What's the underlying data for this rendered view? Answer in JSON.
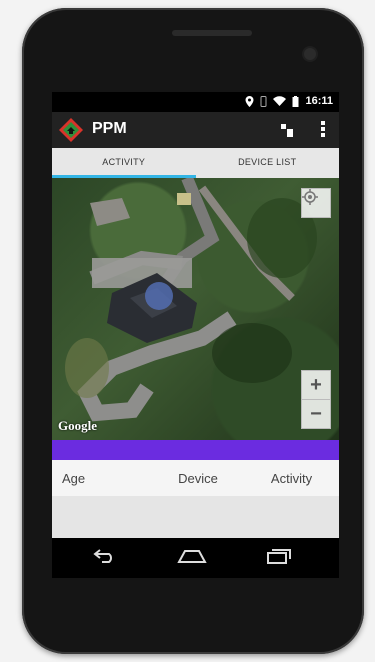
{
  "status_bar": {
    "time": "16:11",
    "icons": [
      "location-icon",
      "vibrate-icon",
      "wifi-icon",
      "battery-icon"
    ]
  },
  "action_bar": {
    "title": "PPM",
    "icons": [
      "app-logo-icon",
      "sync-icon",
      "overflow-menu-icon"
    ],
    "accent_colors": {
      "logo_red": "#d9332a",
      "logo_green": "#2f8f3a"
    }
  },
  "tabs": [
    {
      "label": "ACTIVITY",
      "active": true
    },
    {
      "label": "DEVICE LIST",
      "active": false
    }
  ],
  "map": {
    "zoom_in_label": "+",
    "zoom_out_label": "−",
    "attribution": "Google"
  },
  "band_color": "#6b2ce0",
  "table": {
    "headers": [
      "Age",
      "Device",
      "Activity"
    ]
  },
  "nav_bar": {
    "icons": [
      "back-icon",
      "home-icon",
      "recents-icon"
    ]
  }
}
